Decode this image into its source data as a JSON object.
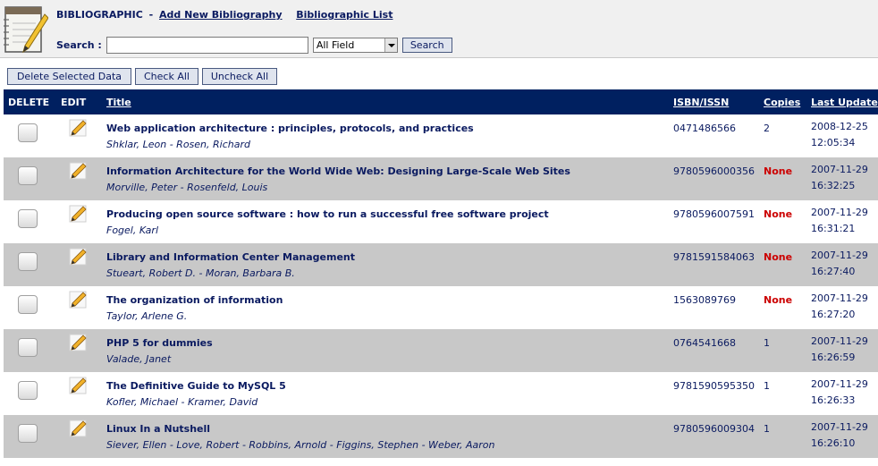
{
  "header": {
    "section": "BIBLIOGRAPHIC",
    "separator": "-",
    "add_link": "Add New Bibliography",
    "list_link": "Bibliographic List"
  },
  "search": {
    "label": "Search :",
    "value": "",
    "field_selected": "All Field",
    "button": "Search"
  },
  "actions": {
    "delete_selected": "Delete Selected Data",
    "check_all": "Check All",
    "uncheck_all": "Uncheck All"
  },
  "columns": {
    "delete": "DELETE",
    "edit": "EDIT",
    "title": "Title",
    "isbn": "ISBN/ISSN",
    "copies": "Copies",
    "updated": "Last Update"
  },
  "rows": [
    {
      "title": "Web application architecture : principles, protocols, and practices",
      "authors": "Shklar, Leon - Rosen, Richard",
      "isbn": "0471486566",
      "copies": "2",
      "date": "2008-12-25",
      "time": "12:05:34"
    },
    {
      "title": "Information Architecture for the World Wide Web: Designing Large-Scale Web Sites",
      "authors": "Morville, Peter - Rosenfeld, Louis",
      "isbn": "9780596000356",
      "copies": "None",
      "date": "2007-11-29",
      "time": "16:32:25"
    },
    {
      "title": "Producing open source software : how to run a successful free software project",
      "authors": "Fogel, Karl",
      "isbn": "9780596007591",
      "copies": "None",
      "date": "2007-11-29",
      "time": "16:31:21"
    },
    {
      "title": "Library and Information Center Management",
      "authors": "Stueart, Robert D. - Moran, Barbara B.",
      "isbn": "9781591584063",
      "copies": "None",
      "date": "2007-11-29",
      "time": "16:27:40"
    },
    {
      "title": "The organization of information",
      "authors": "Taylor, Arlene G.",
      "isbn": "1563089769",
      "copies": "None",
      "date": "2007-11-29",
      "time": "16:27:20"
    },
    {
      "title": "PHP 5 for dummies",
      "authors": "Valade, Janet",
      "isbn": "0764541668",
      "copies": "1",
      "date": "2007-11-29",
      "time": "16:26:59"
    },
    {
      "title": "The Definitive Guide to MySQL 5",
      "authors": "Kofler, Michael - Kramer, David",
      "isbn": "9781590595350",
      "copies": "1",
      "date": "2007-11-29",
      "time": "16:26:33"
    },
    {
      "title": "Linux In a Nutshell",
      "authors": "Siever, Ellen - Love, Robert - Robbins, Arnold - Figgins, Stephen - Weber, Aaron",
      "isbn": "9780596009304",
      "copies": "1",
      "date": "2007-11-29",
      "time": "16:26:10"
    }
  ],
  "colors": {
    "header_bg": "#002060",
    "row_alt": "#c8c8c8",
    "link": "#0a1a60",
    "none": "#cc0000"
  },
  "icons": {
    "logo": "notebook-pencil-icon",
    "edit": "pencil-icon",
    "select": "checkbox-icon",
    "dropdown": "chevron-down-icon"
  }
}
